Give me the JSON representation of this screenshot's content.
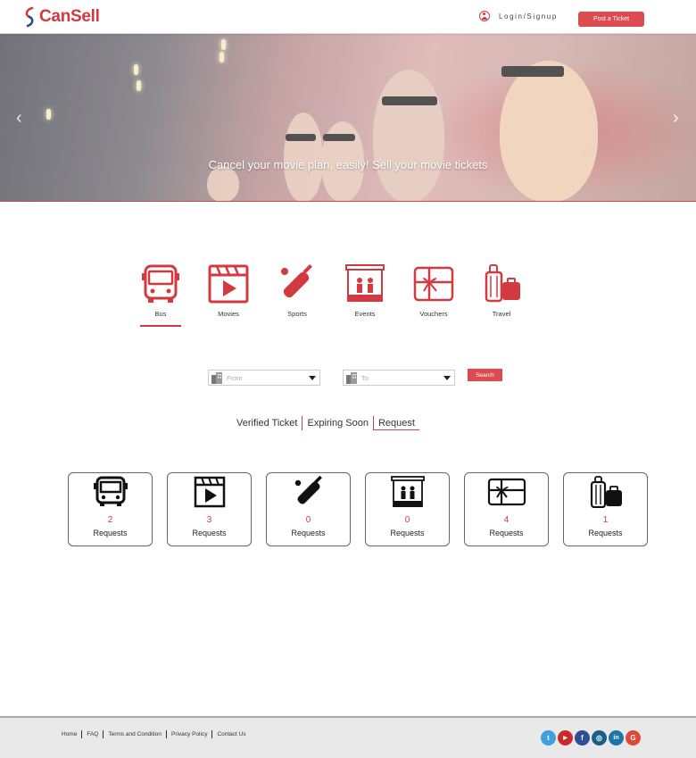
{
  "header": {
    "logo_text": "CanSell",
    "login_label": "Login/Signup",
    "post_button": "Post a Ticket"
  },
  "hero": {
    "caption": "Cancel your movie plan, easily! Sell your movie tickets"
  },
  "categories": [
    {
      "label": "Bus",
      "icon": "bus-icon",
      "active": true
    },
    {
      "label": "Movies",
      "icon": "clapperboard-icon",
      "active": false
    },
    {
      "label": "Sports",
      "icon": "cricket-bat-icon",
      "active": false
    },
    {
      "label": "Events",
      "icon": "stage-icon",
      "active": false
    },
    {
      "label": "Vouchers",
      "icon": "gift-icon",
      "active": false
    },
    {
      "label": "Travel",
      "icon": "luggage-icon",
      "active": false
    }
  ],
  "search": {
    "from_placeholder": "From",
    "to_placeholder": "To",
    "button": "Search"
  },
  "filter_tabs": [
    {
      "label": "Verified Ticket",
      "active": false
    },
    {
      "label": "Expiring Soon",
      "active": false
    },
    {
      "label": "Request",
      "active": true
    }
  ],
  "request_cards": [
    {
      "count": "2",
      "label": "Requests",
      "icon": "bus-icon"
    },
    {
      "count": "3",
      "label": "Requests",
      "icon": "clapperboard-icon"
    },
    {
      "count": "0",
      "label": "Requests",
      "icon": "cricket-bat-icon"
    },
    {
      "count": "0",
      "label": "Requests",
      "icon": "stage-icon"
    },
    {
      "count": "4",
      "label": "Requests",
      "icon": "gift-icon"
    },
    {
      "count": "1",
      "label": "Requests",
      "icon": "luggage-icon"
    }
  ],
  "footer": {
    "links": [
      "Home",
      "FAQ",
      "Terms and Condition",
      "Privacy Policy",
      "Contact Us"
    ],
    "social": [
      {
        "name": "twitter-icon",
        "glyph": "t",
        "color": "#3ea0dc"
      },
      {
        "name": "youtube-icon",
        "glyph": "▶",
        "color": "#cc2a2a"
      },
      {
        "name": "facebook-icon",
        "glyph": "f",
        "color": "#2f4f99"
      },
      {
        "name": "instagram-icon",
        "glyph": "◎",
        "color": "#1b5f86"
      },
      {
        "name": "linkedin-icon",
        "glyph": "in",
        "color": "#1c76a8"
      },
      {
        "name": "google-plus-icon",
        "glyph": "G",
        "color": "#dc4a3a"
      }
    ]
  },
  "colors": {
    "brand_red": "#d33a40",
    "button_red": "#dd4a4f"
  }
}
